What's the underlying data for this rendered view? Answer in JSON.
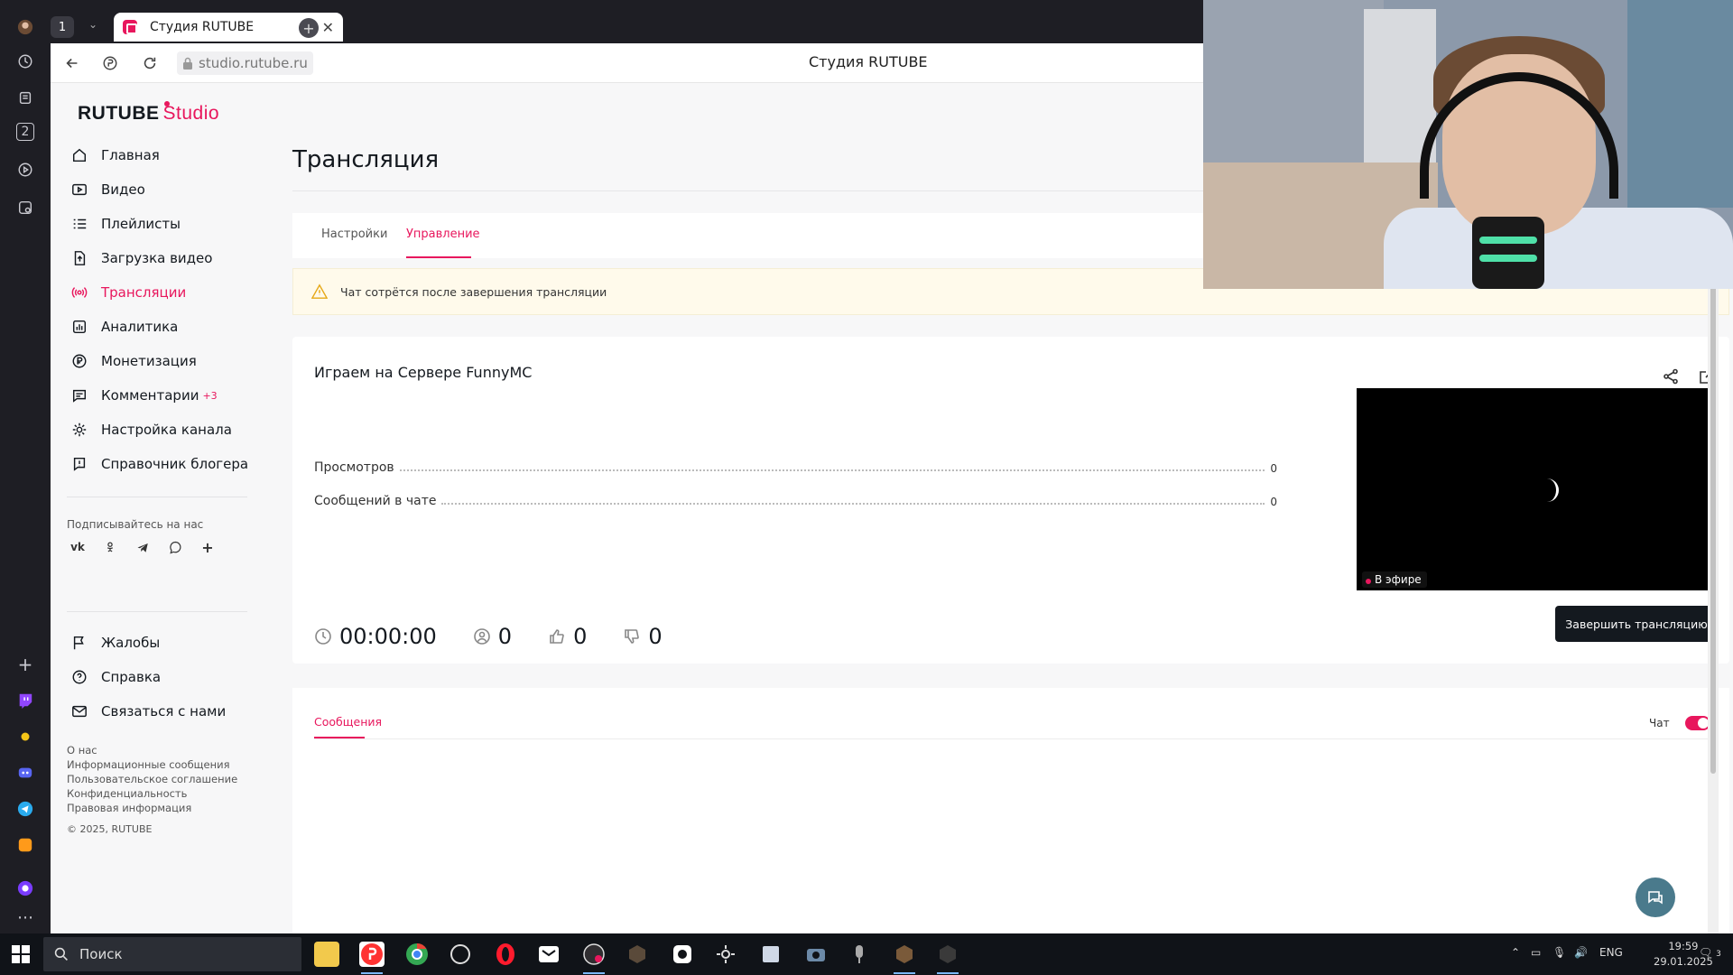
{
  "browser": {
    "tab_count": "1",
    "tab_title": "Студия RUTUBE",
    "url": "studio.rutube.ru",
    "page_title": "Студия RUTUBE",
    "rail_badge": "2"
  },
  "sidebar": {
    "logo_main": "RUTUBE",
    "logo_studio": "Studio",
    "items": [
      {
        "label": "Главная",
        "icon": "home-icon"
      },
      {
        "label": "Видео",
        "icon": "video-icon"
      },
      {
        "label": "Плейлисты",
        "icon": "list-icon"
      },
      {
        "label": "Загрузка видео",
        "icon": "upload-icon"
      },
      {
        "label": "Трансляции",
        "icon": "broadcast-icon",
        "active": true
      },
      {
        "label": "Аналитика",
        "icon": "analytics-icon"
      },
      {
        "label": "Монетизация",
        "icon": "ruble-icon"
      },
      {
        "label": "Комментарии",
        "icon": "comment-icon",
        "badge": "+3"
      },
      {
        "label": "Настройка канала",
        "icon": "gear-icon"
      },
      {
        "label": "Справочник блогера",
        "icon": "book-icon"
      }
    ],
    "follow_label": "Подписывайтесь на нас",
    "bottom_items": [
      {
        "label": "Жалобы",
        "icon": "flag-icon"
      },
      {
        "label": "Справка",
        "icon": "help-icon"
      },
      {
        "label": "Связаться с нами",
        "icon": "mail-icon"
      }
    ],
    "footer_links": [
      "О нас",
      "Информационные сообщения",
      "Пользовательское соглашение",
      "Конфиденциальность",
      "Правовая информация"
    ],
    "copyright": "© 2025, RUTUBE"
  },
  "main": {
    "title": "Трансляция",
    "tabs": [
      "Настройки",
      "Управление"
    ],
    "active_tab": "Управление",
    "warning": "Чат сотрётся после завершения трансляции",
    "stream": {
      "title": "Играем на Сервере FunnyMC",
      "stats": [
        {
          "label": "Просмотров",
          "value": "0"
        },
        {
          "label": "Сообщений в чате",
          "value": "0"
        }
      ],
      "duration": "00:00:00",
      "viewers": "0",
      "likes": "0",
      "dislikes": "0",
      "live_label": "В эфире",
      "end_button": "Завершить трансляцию"
    },
    "chat": {
      "tab_label": "Сообщения",
      "toggle_label": "Чат",
      "toggle_on": true
    }
  },
  "taskbar": {
    "search_placeholder": "Поиск",
    "language": "ENG",
    "time": "19:59",
    "date": "29.01.2025",
    "notifications": "3"
  },
  "colors": {
    "accent": "#e8175d",
    "dark": "#14191f",
    "warning_bg": "#fffaeb"
  }
}
